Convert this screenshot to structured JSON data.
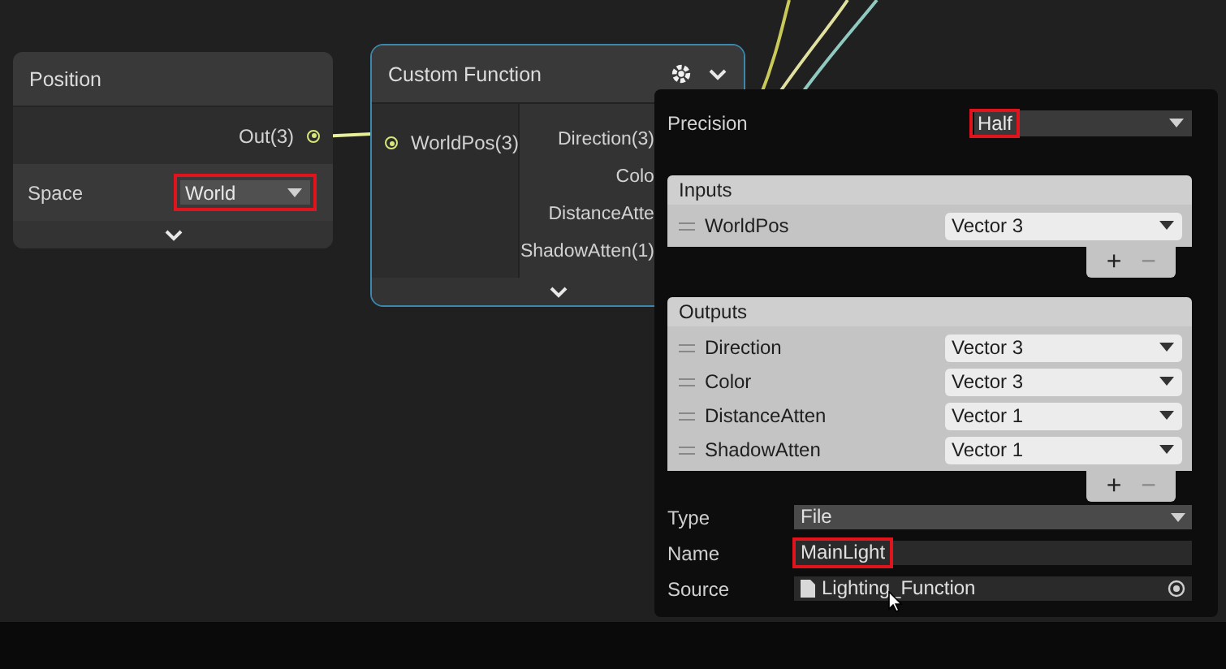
{
  "position_node": {
    "title": "Position",
    "output": "Out(3)",
    "space": {
      "label": "Space",
      "value": "World",
      "highlighted": true
    }
  },
  "custom_function_node": {
    "title": "Custom Function",
    "inputs": [
      "WorldPos(3)"
    ],
    "outputs": [
      "Direction(3)",
      "Colo",
      "DistanceAtte",
      "ShadowAtten(1)"
    ]
  },
  "settings_popup": {
    "precision": {
      "label": "Precision",
      "value": "Half",
      "highlighted": true
    },
    "inputs": {
      "title": "Inputs",
      "rows": [
        {
          "name": "WorldPos",
          "type": "Vector 3"
        }
      ],
      "add_button": {
        "label": "+",
        "disabled": false
      },
      "remove_button": {
        "label": "−",
        "disabled": true
      }
    },
    "outputs": {
      "title": "Outputs",
      "rows": [
        {
          "name": "Direction",
          "type": "Vector 3"
        },
        {
          "name": "Color",
          "type": "Vector 3"
        },
        {
          "name": "DistanceAtten",
          "type": "Vector 1"
        },
        {
          "name": "ShadowAtten",
          "type": "Vector 1"
        }
      ],
      "add_button": {
        "label": "+",
        "disabled": false
      },
      "remove_button": {
        "label": "−",
        "disabled": true
      }
    },
    "type": {
      "label": "Type",
      "value": "File",
      "highlighted": false
    },
    "name": {
      "label": "Name",
      "value": "MainLight",
      "highlighted": true
    },
    "source": {
      "label": "Source",
      "value": "Lighting_Function",
      "highlighted": false
    }
  }
}
